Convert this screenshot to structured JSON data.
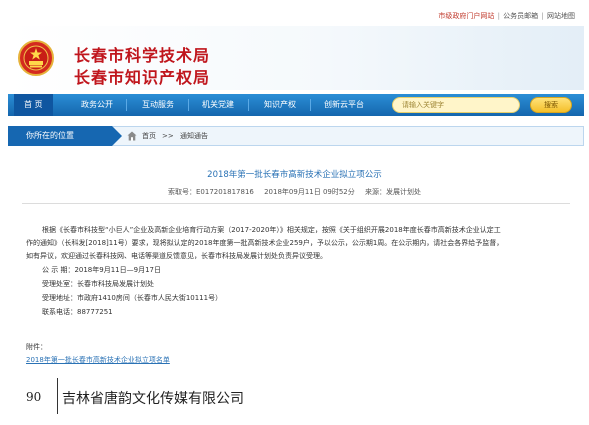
{
  "top_links": {
    "link1": "市级政府门户网站",
    "sep": "|",
    "link2": "公务员邮箱",
    "link3": "网站地图"
  },
  "header": {
    "title_line1": "长春市科学技术局",
    "title_line2": "长春市知识产权局"
  },
  "nav": {
    "items": [
      "首 页",
      "政务公开",
      "互动服务",
      "机关党建",
      "知识产权",
      "创新云平台"
    ]
  },
  "search": {
    "placeholder": "请输入关键字",
    "button": "搜索"
  },
  "location": {
    "label": "你所在的位置",
    "crumb_home": "首页",
    "crumb_sep": ">>",
    "crumb_current": "通知通告"
  },
  "article": {
    "title": "2018年第一批长春市高新技术企业拟立项公示",
    "index_no": "索取号：E017201817816",
    "date": "2018年09月11日 09时52分",
    "source": "来源：发展计划处",
    "lines": [
      "根据《长春市科技型“小巨人”企业及高新企业培育行动方案（2017-2020年）》相关规定，按照《关于组织开展2018年度长春市高新技术企业认定工",
      "作的通知》（长科发[2018]11号）要求，现将拟认定的2018年度第一批高新技术企业259户，予以公示，公示期1周。在公示期内，请社会各界给予监督，",
      "如有异议，欢迎通过长春科技网、电话等渠道反馈意见，长春市科技局发展计划处负责异议受理。",
      "公 示 期：2018年9月11日—9月17日",
      "受理处室：长春市科技局发展计划处",
      "受理地址：市政府1410房间（长春市人民大街10111号）",
      "联系电话：88777251"
    ],
    "attach_label": "附件：",
    "attach_link": "2018年第一批长春市高新技术企业拟立项名单"
  },
  "footer": {
    "page_number": "90",
    "publisher": "吉林省唐韵文化传媒有限公司"
  },
  "colors": {
    "brand_red": "#c0161d",
    "nav_blue": "#1566ad",
    "link_blue": "#2a72b5"
  },
  "icons": {
    "emblem": "national-emblem",
    "home": "home-icon"
  }
}
